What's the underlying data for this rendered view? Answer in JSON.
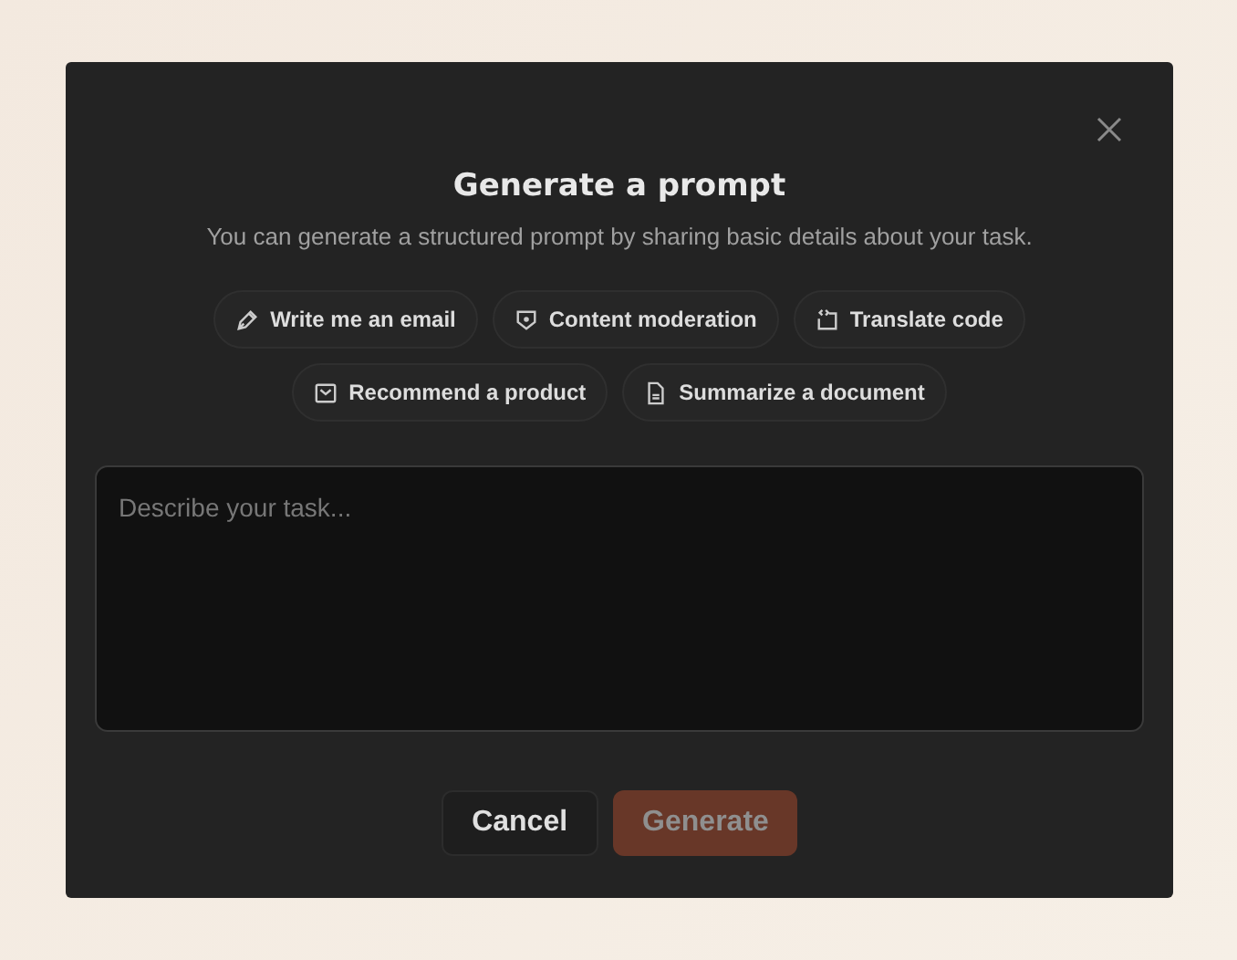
{
  "dialog": {
    "title": "Generate a prompt",
    "subtitle": "You can generate a structured prompt by sharing basic details about your task.",
    "chip_rows": [
      [
        {
          "kind": "pen",
          "label": "Write me an email"
        },
        {
          "kind": "shield",
          "label": "Content moderation"
        },
        {
          "kind": "code",
          "label": "Translate code"
        }
      ],
      [
        {
          "kind": "box",
          "label": "Recommend a product"
        },
        {
          "kind": "doc",
          "label": "Summarize a document"
        }
      ]
    ],
    "task": {
      "placeholder": "Describe your task..."
    },
    "buttons": [
      {
        "kind": "secondary",
        "label": "Cancel",
        "disabled": false
      },
      {
        "kind": "primary",
        "label": "Generate",
        "disabled": true
      }
    ]
  }
}
